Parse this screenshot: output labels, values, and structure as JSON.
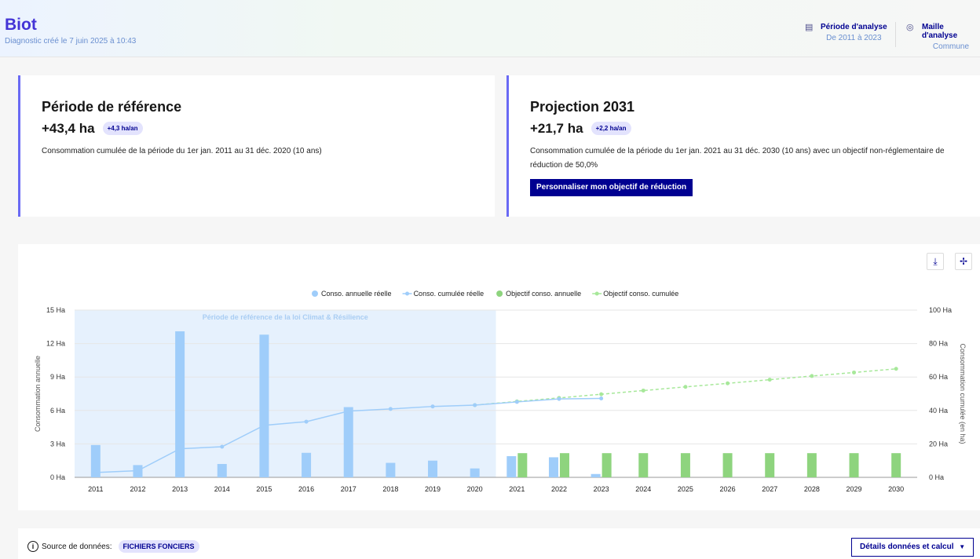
{
  "header": {
    "city": "Biot",
    "created": "Diagnostic créé le 7 juin 2025 à 10:43",
    "period_label": "Période d'analyse",
    "period_value": "De 2011 à 2023",
    "mesh_label": "Maille d'analyse",
    "mesh_value": "Commune"
  },
  "card_reference": {
    "title": "Période de référence",
    "value": "+43,4 ha",
    "badge": "+4,3 ha/an",
    "description": "Consommation cumulée de la période du 1er jan. 2011 au 31 déc. 2020 (10 ans)"
  },
  "card_projection": {
    "title": "Projection 2031",
    "value": "+21,7 ha",
    "badge": "+2,2 ha/an",
    "description": "Consommation cumulée de la période du 1er jan. 2021 au 31 déc. 2030 (10 ans) avec un objectif non-réglementaire de réduction de 50,0%",
    "button": "Personnaliser mon objectif de réduction"
  },
  "toolbar": {
    "download_icon": "download-icon",
    "expand_icon": "expand-icon"
  },
  "chart_data": {
    "type": "bar",
    "categories": [
      "2011",
      "2012",
      "2013",
      "2014",
      "2015",
      "2016",
      "2017",
      "2018",
      "2019",
      "2020",
      "2021",
      "2022",
      "2023",
      "2024",
      "2025",
      "2026",
      "2027",
      "2028",
      "2029",
      "2030"
    ],
    "series": [
      {
        "name": "Conso. annuelle réelle",
        "kind": "bar",
        "axis": "left",
        "color": "#9fcdfa",
        "values": [
          2.9,
          1.1,
          13.1,
          1.2,
          12.8,
          2.2,
          6.3,
          1.3,
          1.5,
          0.8,
          1.9,
          1.8,
          0.3,
          null,
          null,
          null,
          null,
          null,
          null,
          null
        ]
      },
      {
        "name": "Conso. cumulée réelle",
        "kind": "line",
        "axis": "right",
        "color": "#9fcdfa",
        "values": [
          2.9,
          4.0,
          17.1,
          18.3,
          31.1,
          33.3,
          39.6,
          40.9,
          42.4,
          43.2,
          45.1,
          46.9,
          47.2,
          null,
          null,
          null,
          null,
          null,
          null,
          null
        ]
      },
      {
        "name": "Objectif conso. annuelle",
        "kind": "bar",
        "axis": "left",
        "color": "#8ed47e",
        "values": [
          null,
          null,
          null,
          null,
          null,
          null,
          null,
          null,
          null,
          null,
          2.17,
          2.17,
          2.17,
          2.17,
          2.17,
          2.17,
          2.17,
          2.17,
          2.17,
          2.17
        ]
      },
      {
        "name": "Objectif conso. cumulée",
        "kind": "line",
        "axis": "right",
        "color": "#a7e89a",
        "values": [
          null,
          null,
          null,
          null,
          null,
          null,
          null,
          null,
          null,
          43.2,
          45.4,
          47.5,
          49.7,
          51.9,
          54.1,
          56.2,
          58.4,
          60.6,
          62.7,
          64.9
        ]
      }
    ],
    "plotband": {
      "label": "Période de référence de la loi Climat & Résilience",
      "from": "2011",
      "to": "2020"
    },
    "ylabel_left": "Consommation annuelle",
    "ylabel_right": "Consommation cumulée (en ha)",
    "yticks_left": [
      "0 Ha",
      "3 Ha",
      "6 Ha",
      "9 Ha",
      "12 Ha",
      "15 Ha"
    ],
    "yticks_right": [
      "0 Ha",
      "20 Ha",
      "40 Ha",
      "60 Ha",
      "80 Ha",
      "100 Ha"
    ],
    "ylim_left": [
      0,
      15
    ],
    "ylim_right": [
      0,
      100
    ],
    "legend_position": "top-center",
    "grid": true
  },
  "footer": {
    "source_label": "Source de données:",
    "source_badge": "FICHIERS FONCIERS",
    "details_button": "Détails données et calcul",
    "info_icon": "info-icon",
    "chevron_icon": "chevron-down-icon"
  }
}
